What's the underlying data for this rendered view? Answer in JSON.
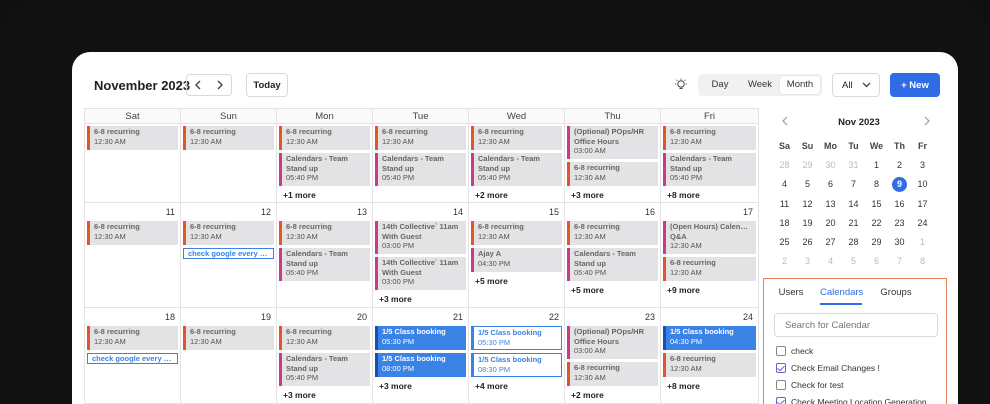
{
  "toolbar": {
    "month_title": "November 2023",
    "prev_icon": "chevron-left-icon",
    "next_icon": "chevron-right-icon",
    "today_label": "Today",
    "theme_icon": "lightbulb-icon",
    "views": [
      "Day",
      "Week",
      "Month"
    ],
    "active_view": "Month",
    "filter_value": "All",
    "new_label": "+ New"
  },
  "colors": {
    "accent": "#2f6ce6",
    "recurring": "#e0552b",
    "standup": "#c73b8a",
    "booking": "#3b82e6"
  },
  "grid": {
    "weekdays": [
      "Sat",
      "Sun",
      "Mon",
      "Tue",
      "Wed",
      "Thu",
      "Fri"
    ],
    "weeks": [
      {
        "days": [
          {
            "date": "",
            "events": [
              {
                "t": "6-8 recurring",
                "s": "12:30 AM",
                "k": "rec"
              }
            ],
            "more": ""
          },
          {
            "date": "",
            "events": [
              {
                "t": "6-8 recurring",
                "s": "12:30 AM",
                "k": "rec"
              }
            ],
            "more": ""
          },
          {
            "date": "",
            "events": [
              {
                "t": "6-8 recurring",
                "s": "12:30 AM",
                "k": "rec"
              },
              {
                "t": "Calendars - Team",
                "t2": "Stand up",
                "s": "05:40 PM",
                "k": "pink"
              }
            ],
            "more": "+1 more"
          },
          {
            "date": "",
            "events": [
              {
                "t": "6-8 recurring",
                "s": "12:30 AM",
                "k": "rec"
              },
              {
                "t": "Calendars - Team",
                "t2": "Stand up",
                "s": "05:40 PM",
                "k": "pink"
              }
            ],
            "more": ""
          },
          {
            "date": "",
            "events": [
              {
                "t": "6-8 recurring",
                "s": "12:30 AM",
                "k": "rec"
              },
              {
                "t": "Calendars - Team",
                "t2": "Stand up",
                "s": "05:40 PM",
                "k": "pink"
              }
            ],
            "more": "+2 more"
          },
          {
            "date": "",
            "events": [
              {
                "t": "(Optional) POps/HR",
                "t2": "Office Hours",
                "s": "03:00 AM",
                "k": "pink"
              },
              {
                "t": "6-8 recurring",
                "s": "12:30 AM",
                "k": "rec"
              }
            ],
            "more": "+3 more"
          },
          {
            "date": "",
            "events": [
              {
                "t": "6-8 recurring",
                "s": "12:30 AM",
                "k": "rec"
              },
              {
                "t": "Calendars - Team",
                "t2": "Stand up",
                "s": "05:40 PM",
                "k": "pink"
              }
            ],
            "more": "+8 more"
          }
        ]
      },
      {
        "days": [
          {
            "date": "11",
            "events": [
              {
                "t": "6-8 recurring",
                "s": "12:30 AM",
                "k": "rec"
              }
            ],
            "more": ""
          },
          {
            "date": "12",
            "events": [
              {
                "t": "6-8 recurring",
                "s": "12:30 AM",
                "k": "rec"
              },
              {
                "t": "check google every 3...",
                "k": "chip"
              }
            ],
            "more": ""
          },
          {
            "date": "13",
            "events": [
              {
                "t": "6-8 recurring",
                "s": "12:30 AM",
                "k": "rec"
              },
              {
                "t": "Calendars - Team",
                "t2": "Stand up",
                "s": "05:40 PM",
                "k": "pink"
              }
            ],
            "more": ""
          },
          {
            "date": "14",
            "events": [
              {
                "t": "14th Collective` 11am",
                "t2": "With Guest",
                "s": "03:00 PM",
                "k": "pink"
              },
              {
                "t": "14th Collective` 11am",
                "t2": "With Guest",
                "s": "03:00 PM",
                "k": "pink"
              }
            ],
            "more": "+3 more"
          },
          {
            "date": "15",
            "events": [
              {
                "t": "6-8 recurring",
                "s": "12:30 AM",
                "k": "rec"
              },
              {
                "t": "Ajay A",
                "s": "04:30 PM",
                "k": "pink"
              }
            ],
            "more": "+5 more"
          },
          {
            "date": "16",
            "events": [
              {
                "t": "6-8 recurring",
                "s": "12:30 AM",
                "k": "rec"
              },
              {
                "t": "Calendars - Team",
                "t2": "Stand up",
                "s": "05:40 PM",
                "k": "pink"
              }
            ],
            "more": "+5 more"
          },
          {
            "date": "17",
            "events": [
              {
                "t": "(Open Hours) Calendar",
                "t2": "Q&A",
                "s": "12:30 AM",
                "k": "pink"
              },
              {
                "t": "6-8 recurring",
                "s": "12:30 AM",
                "k": "rec"
              }
            ],
            "more": "+9 more"
          }
        ]
      },
      {
        "days": [
          {
            "date": "18",
            "events": [
              {
                "t": "6-8 recurring",
                "s": "12:30 AM",
                "k": "rec"
              },
              {
                "t": "check google every 3 ...",
                "k": "chip"
              }
            ],
            "more": ""
          },
          {
            "date": "19",
            "events": [
              {
                "t": "6-8 recurring",
                "s": "12:30 AM",
                "k": "rec"
              }
            ],
            "more": ""
          },
          {
            "date": "20",
            "events": [
              {
                "t": "6-8 recurring",
                "s": "12:30 AM",
                "k": "rec"
              },
              {
                "t": "Calendars - Team",
                "t2": "Stand up",
                "s": "05:40 PM",
                "k": "pink"
              }
            ],
            "more": "+3 more"
          },
          {
            "date": "21",
            "events": [
              {
                "t": "1/5  Class booking",
                "s": "05:30 PM",
                "k": "blue"
              },
              {
                "t": "1/5  Class booking",
                "s": "08:00 PM",
                "k": "blue"
              }
            ],
            "more": "+3 more"
          },
          {
            "date": "22",
            "events": [
              {
                "t": "1/5  Class booking",
                "s": "05:30 PM",
                "k": "outline"
              },
              {
                "t": "1/5  Class booking",
                "s": "08:30 PM",
                "k": "outline"
              }
            ],
            "more": "+4 more"
          },
          {
            "date": "23",
            "events": [
              {
                "t": "(Optional) POps/HR",
                "t2": "Office Hours",
                "s": "03:00 AM",
                "k": "pink"
              },
              {
                "t": "6-8 recurring",
                "s": "12:30 AM",
                "k": "rec"
              }
            ],
            "more": "+2 more"
          },
          {
            "date": "24",
            "events": [
              {
                "t": "1/5  Class booking",
                "s": "04:30 PM",
                "k": "blue"
              },
              {
                "t": "6-8 recurring",
                "s": "12:30 AM",
                "k": "rec"
              }
            ],
            "more": "+8 more"
          }
        ]
      }
    ]
  },
  "mini_calendar": {
    "title": "Nov 2023",
    "prev_icon": "chevron-left-icon",
    "next_icon": "chevron-right-icon",
    "weekdays": [
      "Sa",
      "Su",
      "Mo",
      "Tu",
      "We",
      "Th",
      "Fr"
    ],
    "rows": [
      [
        "28",
        "29",
        "30",
        "31",
        "1",
        "2",
        "3"
      ],
      [
        "4",
        "5",
        "6",
        "7",
        "8",
        "9",
        "10"
      ],
      [
        "11",
        "12",
        "13",
        "14",
        "15",
        "16",
        "17"
      ],
      [
        "18",
        "19",
        "20",
        "21",
        "22",
        "23",
        "24"
      ],
      [
        "25",
        "26",
        "27",
        "28",
        "29",
        "30",
        "1"
      ],
      [
        "2",
        "3",
        "4",
        "5",
        "6",
        "7",
        "8"
      ]
    ],
    "dim_first_row": 4,
    "dim_from_row5": 6,
    "today": "9"
  },
  "calendar_panel": {
    "tabs": [
      "Users",
      "Calendars",
      "Groups"
    ],
    "active_tab": "Calendars",
    "search_placeholder": "Search for Calendar",
    "items": [
      {
        "label": "check",
        "checked": false
      },
      {
        "label": "Check Email Changes !",
        "checked": true
      },
      {
        "label": "Check for test",
        "checked": false
      },
      {
        "label": "Check Meeting Location Generation ...",
        "checked": true
      }
    ]
  }
}
